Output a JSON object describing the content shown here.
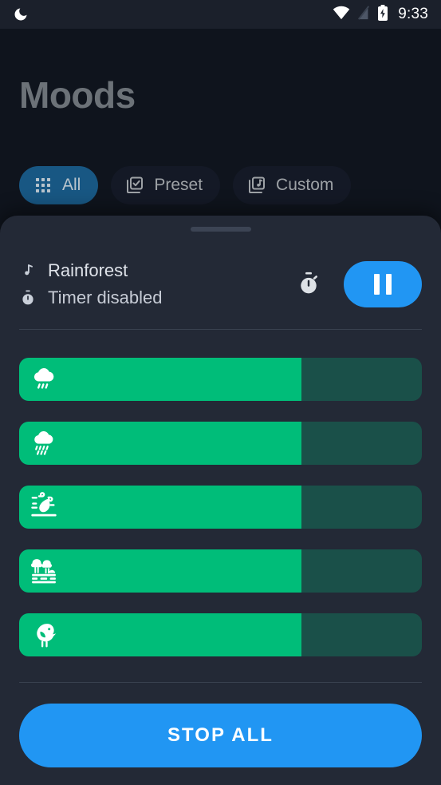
{
  "status_bar": {
    "left_icon": "moon-icon",
    "wifi_icon": "wifi-icon",
    "signal_icon": "signal-off-icon",
    "battery_icon": "battery-charging-icon",
    "time": "9:33"
  },
  "page": {
    "title": "Moods"
  },
  "filters": {
    "chips": [
      {
        "label": "All",
        "icon": "grid-apps-icon",
        "selected": true
      },
      {
        "label": "Preset",
        "icon": "checkbox-library-icon",
        "selected": false
      },
      {
        "label": "Custom",
        "icon": "music-library-icon",
        "selected": false
      }
    ]
  },
  "sheet": {
    "handle": "drag-handle",
    "now_playing": {
      "track_icon": "music-note-icon",
      "track_name": "Rainforest",
      "timer_icon": "stopwatch-icon",
      "timer_status": "Timer disabled",
      "timer_button_icon": "stopwatch-icon",
      "play_button_icon": "pause-icon"
    },
    "sliders": [
      {
        "name": "rain-light",
        "icon": "cloud-rain-icon",
        "value": 70
      },
      {
        "name": "rain-heavy",
        "icon": "cloud-heavy-rain-icon",
        "value": 70
      },
      {
        "name": "wind-leaves",
        "icon": "wind-leaf-icon",
        "value": 70
      },
      {
        "name": "forest",
        "icon": "forest-trees-icon",
        "value": 70
      },
      {
        "name": "birds",
        "icon": "bird-icon",
        "value": 70
      }
    ],
    "stop_all_label": "STOP ALL"
  },
  "colors": {
    "accent_blue": "#2196f3",
    "chip_selected": "#185783",
    "slider_fill": "#00bd79",
    "slider_track": "#1a5049",
    "sheet_bg": "#232936",
    "page_bg": "#0f141d",
    "status_bg": "#1b202b",
    "title_gray": "#6c7278"
  }
}
